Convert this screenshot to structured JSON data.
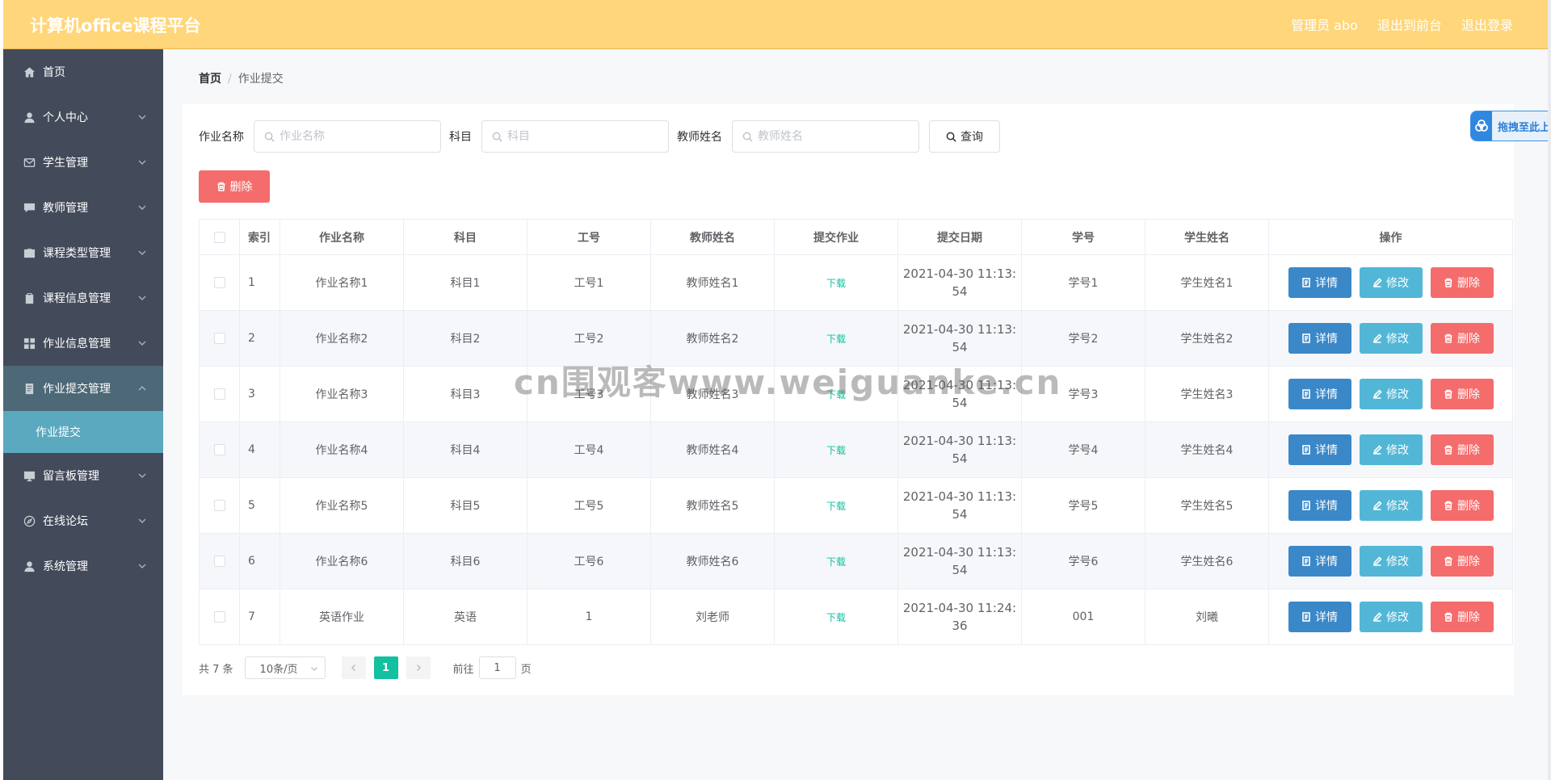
{
  "header": {
    "brand": "计算机office课程平台",
    "admin": "管理员 abo",
    "to_front": "退出到前台",
    "logout": "退出登录"
  },
  "sidebar": {
    "items": [
      {
        "label": "首页",
        "icon": "home-icon"
      },
      {
        "label": "个人中心",
        "icon": "user-icon"
      },
      {
        "label": "学生管理",
        "icon": "mail-icon"
      },
      {
        "label": "教师管理",
        "icon": "chat-icon"
      },
      {
        "label": "课程类型管理",
        "icon": "briefcase-icon"
      },
      {
        "label": "课程信息管理",
        "icon": "clipboard-icon"
      },
      {
        "label": "作业信息管理",
        "icon": "grid-icon"
      },
      {
        "label": "作业提交管理",
        "icon": "document-icon"
      },
      {
        "label": "留言板管理",
        "icon": "monitor-icon"
      },
      {
        "label": "在线论坛",
        "icon": "compass-icon"
      },
      {
        "label": "系统管理",
        "icon": "user-icon"
      }
    ],
    "sub_item": "作业提交"
  },
  "breadcrumb": {
    "home": "首页",
    "sep": "/",
    "current": "作业提交"
  },
  "search": {
    "homework_label": "作业名称",
    "homework_placeholder": "作业名称",
    "subject_label": "科目",
    "subject_placeholder": "科目",
    "teacher_label": "教师姓名",
    "teacher_placeholder": "教师姓名",
    "query_label": "查询"
  },
  "toolbar": {
    "delete_label": "删除"
  },
  "table": {
    "headers": [
      "索引",
      "作业名称",
      "科目",
      "工号",
      "教师姓名",
      "提交作业",
      "提交日期",
      "学号",
      "学生姓名",
      "操作"
    ],
    "rows": [
      {
        "index": "1",
        "name": "作业名称1",
        "subject": "科目1",
        "job_no": "工号1",
        "teacher": "教师姓名1",
        "file": "下载",
        "date": "2021-04-30 11:13:54",
        "student_no": "学号1",
        "student": "学生姓名1"
      },
      {
        "index": "2",
        "name": "作业名称2",
        "subject": "科目2",
        "job_no": "工号2",
        "teacher": "教师姓名2",
        "file": "下载",
        "date": "2021-04-30 11:13:54",
        "student_no": "学号2",
        "student": "学生姓名2"
      },
      {
        "index": "3",
        "name": "作业名称3",
        "subject": "科目3",
        "job_no": "工号3",
        "teacher": "教师姓名3",
        "file": "下载",
        "date": "2021-04-30 11:13:54",
        "student_no": "学号3",
        "student": "学生姓名3"
      },
      {
        "index": "4",
        "name": "作业名称4",
        "subject": "科目4",
        "job_no": "工号4",
        "teacher": "教师姓名4",
        "file": "下载",
        "date": "2021-04-30 11:13:54",
        "student_no": "学号4",
        "student": "学生姓名4"
      },
      {
        "index": "5",
        "name": "作业名称5",
        "subject": "科目5",
        "job_no": "工号5",
        "teacher": "教师姓名5",
        "file": "下载",
        "date": "2021-04-30 11:13:54",
        "student_no": "学号5",
        "student": "学生姓名5"
      },
      {
        "index": "6",
        "name": "作业名称6",
        "subject": "科目6",
        "job_no": "工号6",
        "teacher": "教师姓名6",
        "file": "下载",
        "date": "2021-04-30 11:13:54",
        "student_no": "学号6",
        "student": "学生姓名6"
      },
      {
        "index": "7",
        "name": "英语作业",
        "subject": "英语",
        "job_no": "1",
        "teacher": "刘老师",
        "file": "下载",
        "date": "2021-04-30 11:24:36",
        "student_no": "001",
        "student": "刘曦"
      }
    ],
    "actions": {
      "detail": "详情",
      "edit": "修改",
      "delete": "删除"
    }
  },
  "pagination": {
    "total": "共 7 条",
    "page_size": "10条/页",
    "current_page": "1",
    "goto_label": "前往",
    "goto_value": "1",
    "page_suffix": "页"
  },
  "widget": {
    "label": "拖拽至此上"
  },
  "watermark": "cn围观客www.weiguanke.cn",
  "colors": {
    "header": "#ffd679",
    "sidebar": "#434a5a",
    "active_sub": "#5aa9bf",
    "primary": "#13c0a0",
    "danger": "#f56c6c",
    "detail": "#3b88c8",
    "edit": "#52b7d6"
  }
}
